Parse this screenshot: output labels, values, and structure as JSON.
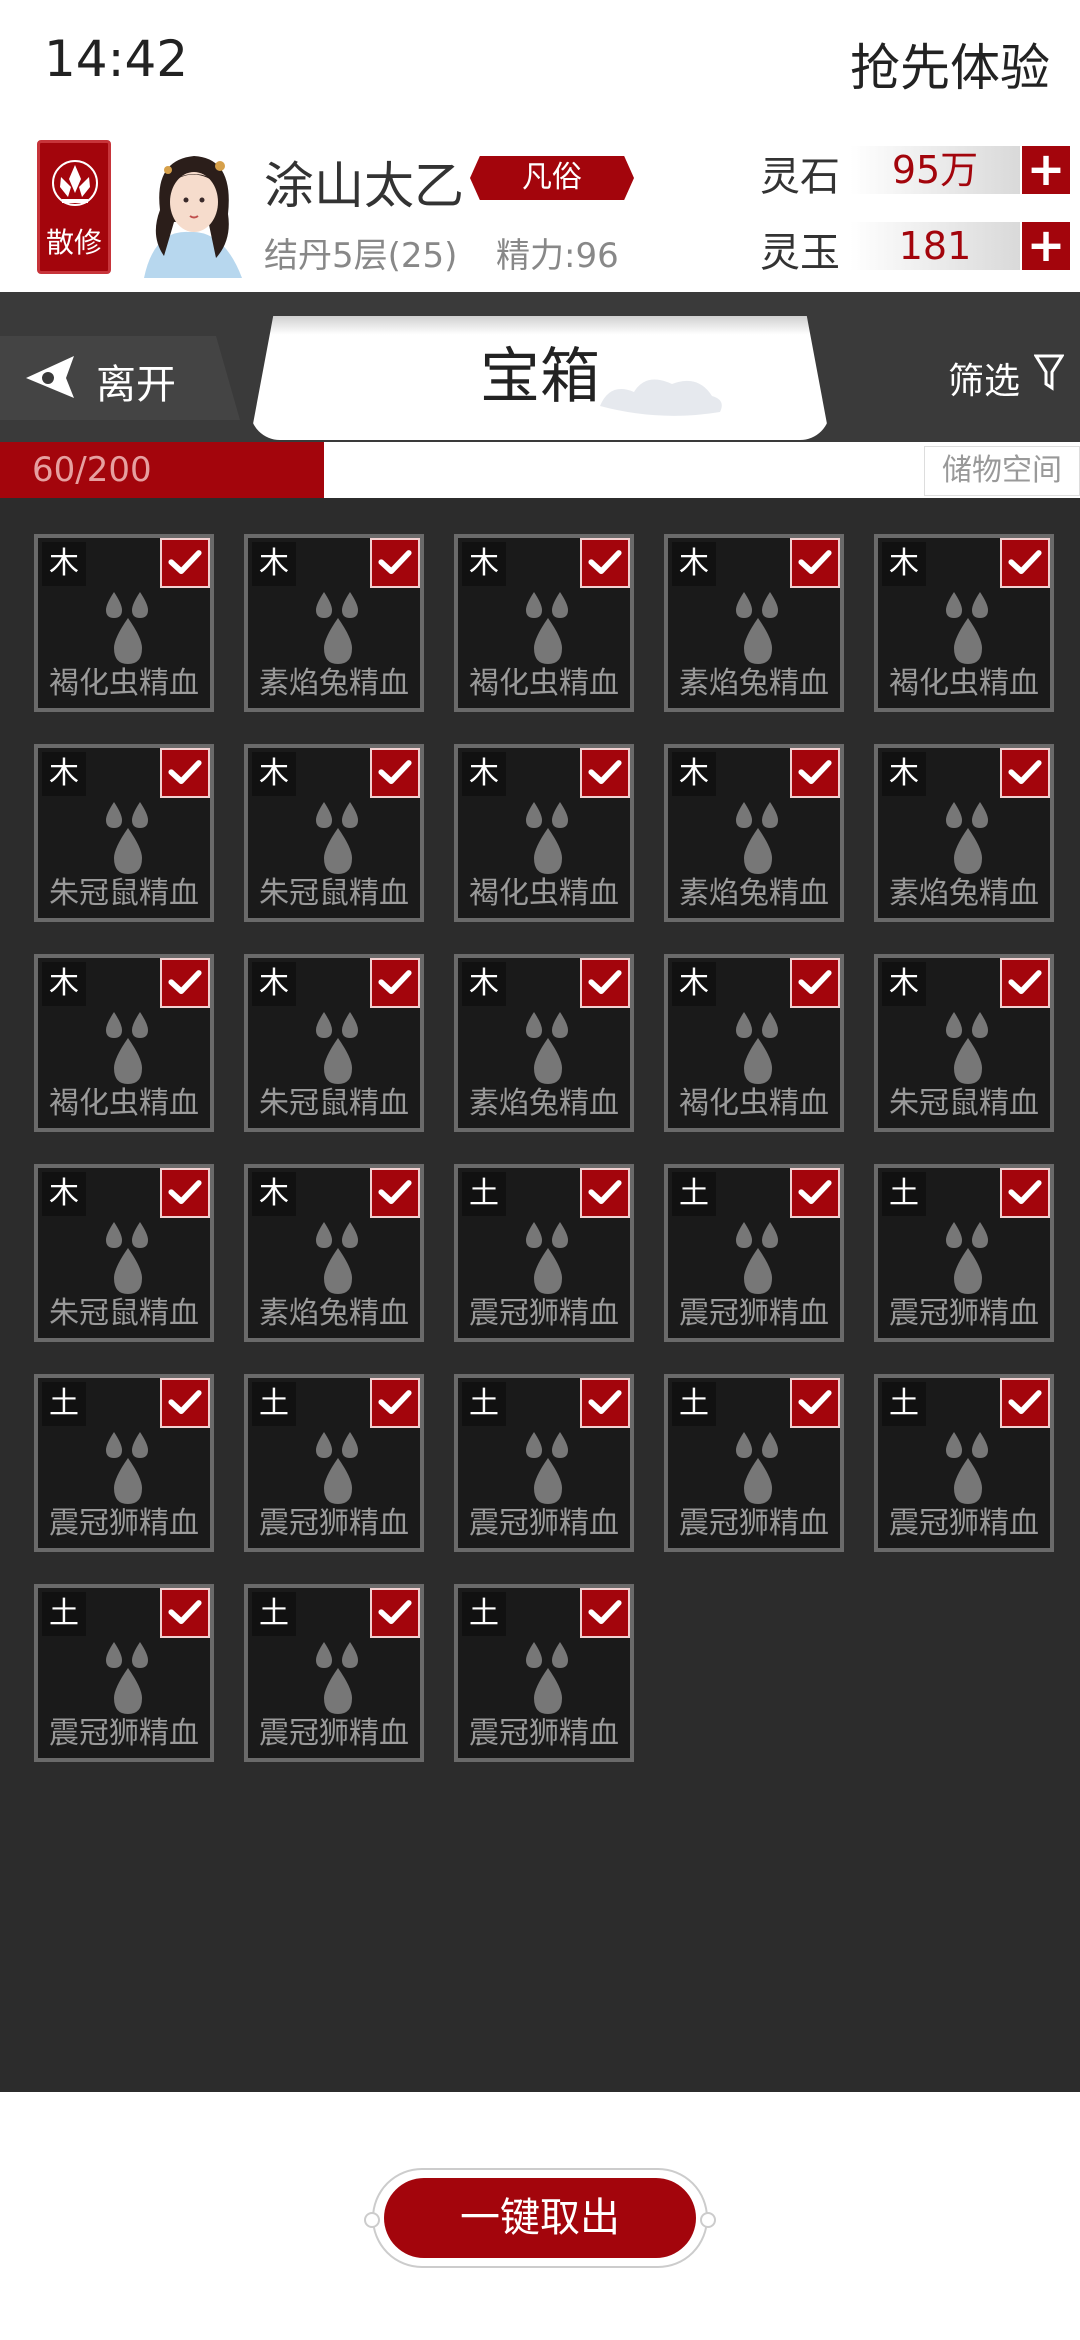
{
  "status_bar": {
    "time": "14:42",
    "promo": "抢先体验"
  },
  "profile": {
    "badge_label": "散修",
    "name": "涂山太乙",
    "rank": "凡俗",
    "level": "结丹5层(25)",
    "energy": "精力:96",
    "currencies": [
      {
        "label": "灵石",
        "value": "95万"
      },
      {
        "label": "灵玉",
        "value": "181"
      }
    ]
  },
  "nav": {
    "back_label": "离开",
    "title": "宝箱",
    "filter_label": "筛选"
  },
  "capacity": {
    "text": "60/200",
    "used": 60,
    "max": 200,
    "storage_label": "储物空间"
  },
  "items": [
    {
      "element": "木",
      "name": "褐化虫精血",
      "selected": true
    },
    {
      "element": "木",
      "name": "素焰兔精血",
      "selected": true
    },
    {
      "element": "木",
      "name": "褐化虫精血",
      "selected": true
    },
    {
      "element": "木",
      "name": "素焰兔精血",
      "selected": true
    },
    {
      "element": "木",
      "name": "褐化虫精血",
      "selected": true
    },
    {
      "element": "木",
      "name": "朱冠鼠精血",
      "selected": true
    },
    {
      "element": "木",
      "name": "朱冠鼠精血",
      "selected": true
    },
    {
      "element": "木",
      "name": "褐化虫精血",
      "selected": true
    },
    {
      "element": "木",
      "name": "素焰兔精血",
      "selected": true
    },
    {
      "element": "木",
      "name": "素焰兔精血",
      "selected": true
    },
    {
      "element": "木",
      "name": "褐化虫精血",
      "selected": true
    },
    {
      "element": "木",
      "name": "朱冠鼠精血",
      "selected": true
    },
    {
      "element": "木",
      "name": "素焰兔精血",
      "selected": true
    },
    {
      "element": "木",
      "name": "褐化虫精血",
      "selected": true
    },
    {
      "element": "木",
      "name": "朱冠鼠精血",
      "selected": true
    },
    {
      "element": "木",
      "name": "朱冠鼠精血",
      "selected": true
    },
    {
      "element": "木",
      "name": "素焰兔精血",
      "selected": true
    },
    {
      "element": "土",
      "name": "震冠狮精血",
      "selected": true
    },
    {
      "element": "土",
      "name": "震冠狮精血",
      "selected": true
    },
    {
      "element": "土",
      "name": "震冠狮精血",
      "selected": true
    },
    {
      "element": "土",
      "name": "震冠狮精血",
      "selected": true
    },
    {
      "element": "土",
      "name": "震冠狮精血",
      "selected": true
    },
    {
      "element": "土",
      "name": "震冠狮精血",
      "selected": true
    },
    {
      "element": "土",
      "name": "震冠狮精血",
      "selected": true
    },
    {
      "element": "土",
      "name": "震冠狮精血",
      "selected": true
    },
    {
      "element": "土",
      "name": "震冠狮精血",
      "selected": true
    },
    {
      "element": "土",
      "name": "震冠狮精血",
      "selected": true
    },
    {
      "element": "土",
      "name": "震冠狮精血",
      "selected": true
    }
  ],
  "take_all_label": "一键取出",
  "colors": {
    "accent": "#a3050c",
    "grid_bg": "#2c2c2c",
    "nav_bg": "#3a3a3a"
  }
}
